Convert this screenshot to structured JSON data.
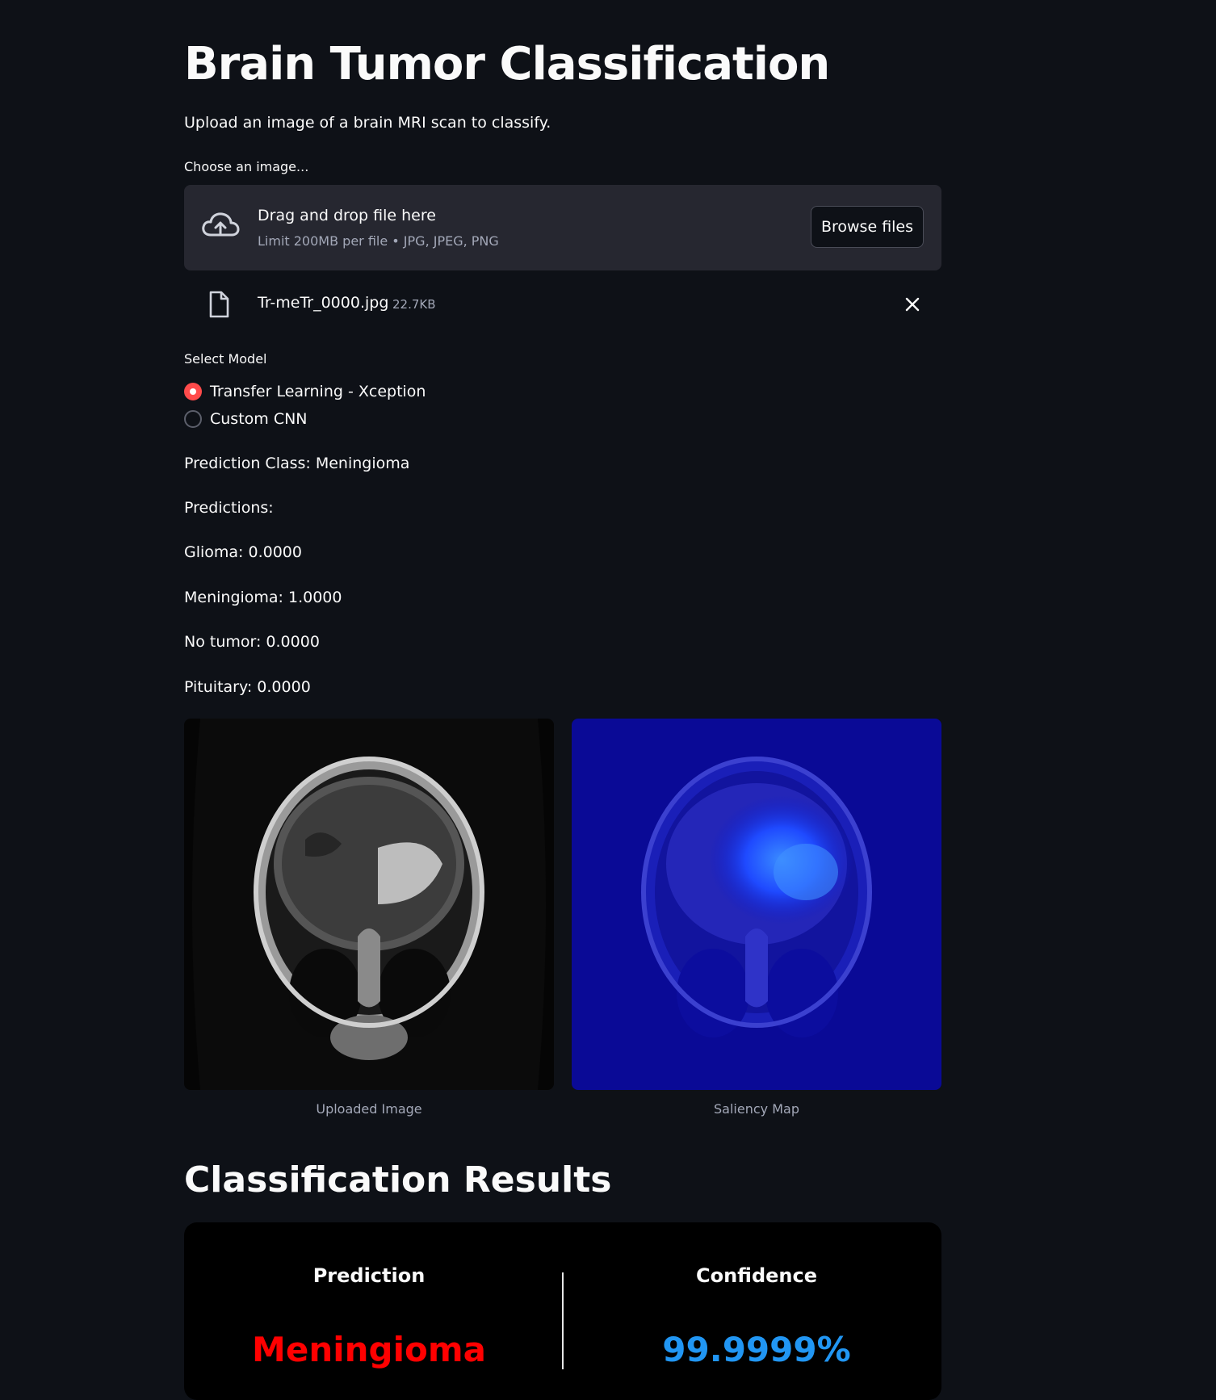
{
  "page": {
    "title": "Brain Tumor Classification",
    "subtitle": "Upload an image of a brain MRI scan to classify."
  },
  "uploader": {
    "label": "Choose an image...",
    "dropzone_title": "Drag and drop file here",
    "dropzone_hint": "Limit 200MB per file • JPG, JPEG, PNG",
    "browse_label": "Browse files",
    "file": {
      "name": "Tr-meTr_0000.jpg",
      "size": "22.7KB"
    }
  },
  "model_select": {
    "label": "Select Model",
    "options": [
      {
        "label": "Transfer Learning - Xception",
        "selected": true
      },
      {
        "label": "Custom CNN",
        "selected": false
      }
    ]
  },
  "prediction": {
    "class_line": "Prediction Class: Meningioma",
    "predictions_heading": "Predictions:",
    "scores": [
      "Glioma: 0.0000",
      "Meningioma: 1.0000",
      "No tumor: 0.0000",
      "Pituitary: 0.0000"
    ]
  },
  "images": {
    "uploaded_caption": "Uploaded Image",
    "saliency_caption": "Saliency Map"
  },
  "results": {
    "title": "Classification Results",
    "prediction_heading": "Prediction",
    "prediction_value": "Meningioma",
    "confidence_heading": "Confidence",
    "confidence_value": "99.9999%"
  },
  "colors": {
    "background": "#0e1117",
    "accent_red": "#ff4b4b",
    "prediction_red": "#ff0000",
    "confidence_blue": "#2196f3"
  }
}
